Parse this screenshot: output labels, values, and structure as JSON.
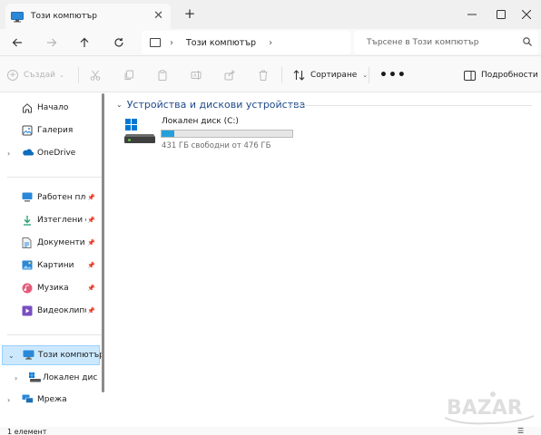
{
  "window": {
    "tab_title": "Този компютър",
    "tab_close_icon": "close-icon",
    "new_tab_icon": "plus-icon",
    "controls": {
      "minimize": "—",
      "maximize": "☐",
      "close": "✕"
    }
  },
  "navigation": {
    "back_icon": "arrow-left-icon",
    "forward_icon": "arrow-right-icon",
    "up_icon": "arrow-up-icon",
    "refresh_icon": "refresh-icon",
    "breadcrumb": [
      "Този компютър"
    ],
    "search_placeholder": "Търсене в Този компютър"
  },
  "toolbar": {
    "new_label": "Създай",
    "sort_label": "Сортиране",
    "more_label": "•••",
    "details_label": "Подробности",
    "disabled_icons": [
      "cut-icon",
      "copy-icon",
      "paste-icon",
      "rename-icon",
      "share-icon",
      "delete-icon"
    ]
  },
  "sidebar": {
    "items": [
      {
        "label": "Начало",
        "icon": "home-icon"
      },
      {
        "label": "Галерия",
        "icon": "gallery-icon"
      },
      {
        "label": "OneDrive",
        "icon": "cloud-icon"
      },
      {
        "label": "Работен пло",
        "icon": "desktop-icon",
        "pinned": true
      },
      {
        "label": "Изтеглени ф",
        "icon": "download-icon",
        "pinned": true
      },
      {
        "label": "Документи",
        "icon": "documents-icon",
        "pinned": true
      },
      {
        "label": "Картини",
        "icon": "pictures-icon",
        "pinned": true
      },
      {
        "label": "Музика",
        "icon": "music-icon",
        "pinned": true
      },
      {
        "label": "Видеоклипо",
        "icon": "videos-icon",
        "pinned": true
      },
      {
        "label": "Този компютър",
        "icon": "computer-icon",
        "selected": true
      },
      {
        "label": "Локален диск",
        "icon": "drive-icon"
      },
      {
        "label": "Мрежа",
        "icon": "network-icon"
      }
    ]
  },
  "main": {
    "group_header": "Устройства и дискови устройства",
    "drives": [
      {
        "name": "Локален диск (C:)",
        "free_text": "431 ГБ свободни от 476 ГБ",
        "used_fraction": 0.095
      }
    ]
  },
  "status": {
    "count": "1 елемент"
  },
  "watermark": {
    "text": "BAZAR"
  },
  "colors": {
    "accent": "#0067c0",
    "selection": "#cce8ff",
    "drive_bar": "#26a0da"
  }
}
